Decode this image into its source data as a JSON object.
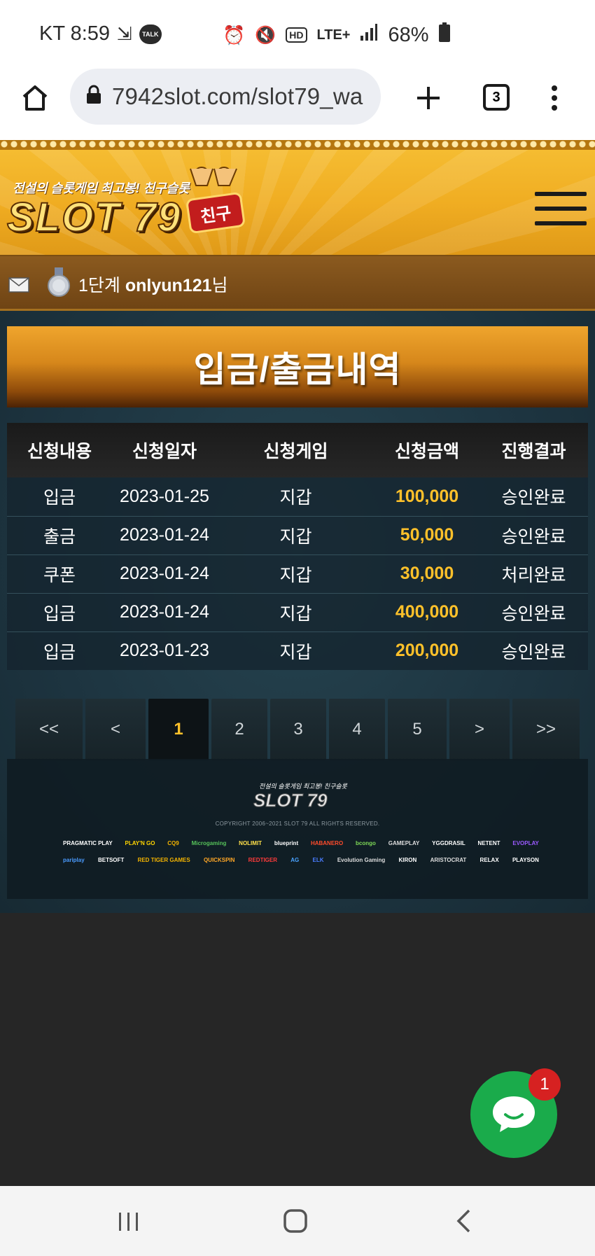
{
  "status_bar": {
    "carrier_time": "KT 8:59",
    "talk_label": "TALK",
    "network": "LTE+",
    "battery": "68%"
  },
  "browser": {
    "url": "7942slot.com/slot79_wa",
    "tab_count": "3"
  },
  "header": {
    "tagline": "전설의 슬롯게임 최고봉! 친구슬롯",
    "logo_text": "SLOT 79",
    "logo_badge": "친구"
  },
  "user": {
    "level": "1단계",
    "username": "onlyun121",
    "suffix": "님"
  },
  "page": {
    "title": "입금/출금내역"
  },
  "table": {
    "headers": [
      "신청내용",
      "신청일자",
      "신청게임",
      "신청금액",
      "진행결과"
    ],
    "rows": [
      [
        "입금",
        "2023-01-25",
        "지갑",
        "100,000",
        "승인완료"
      ],
      [
        "출금",
        "2023-01-24",
        "지갑",
        "50,000",
        "승인완료"
      ],
      [
        "쿠폰",
        "2023-01-24",
        "지갑",
        "30,000",
        "처리완료"
      ],
      [
        "입금",
        "2023-01-24",
        "지갑",
        "400,000",
        "승인완료"
      ],
      [
        "입금",
        "2023-01-23",
        "지갑",
        "200,000",
        "승인완료"
      ]
    ]
  },
  "pagination": {
    "first": "<<",
    "prev": "<",
    "pages": [
      "1",
      "2",
      "3",
      "4",
      "5"
    ],
    "current": "1",
    "next": ">",
    "last": ">>"
  },
  "footer": {
    "tagline": "전설의 슬롯게임 최고봉! 친구슬롯",
    "logo_text": "SLOT 79",
    "copyright": "COPYRIGHT 2006~2021 SLOT 79 ALL RIGHTS RESERVED.",
    "providers_row1": [
      "PRAGMATIC PLAY",
      "PLAY'N GO",
      "CQ9",
      "Microgaming",
      "NOLIMIT",
      "blueprint",
      "HABANERO",
      "bcongo",
      "GAMEPLAY",
      "YGGDRASIL",
      "NETENT",
      "EVOPLAY"
    ],
    "providers_row2": [
      "pariplay",
      "BETSOFT",
      "RED TIGER GAMES",
      "QUICKSPIN",
      "REDTIGER",
      "AG",
      "ELK",
      "Evolution Gaming",
      "KIRON",
      "ARISTOCRAT",
      "RELAX",
      "PLAYSON"
    ]
  },
  "chat": {
    "badge_count": "1"
  },
  "colors": {
    "accent_gold": "#ffc12a",
    "header_orange": "#f0ad22",
    "chat_green": "#1aab4b",
    "badge_red": "#d62121"
  }
}
